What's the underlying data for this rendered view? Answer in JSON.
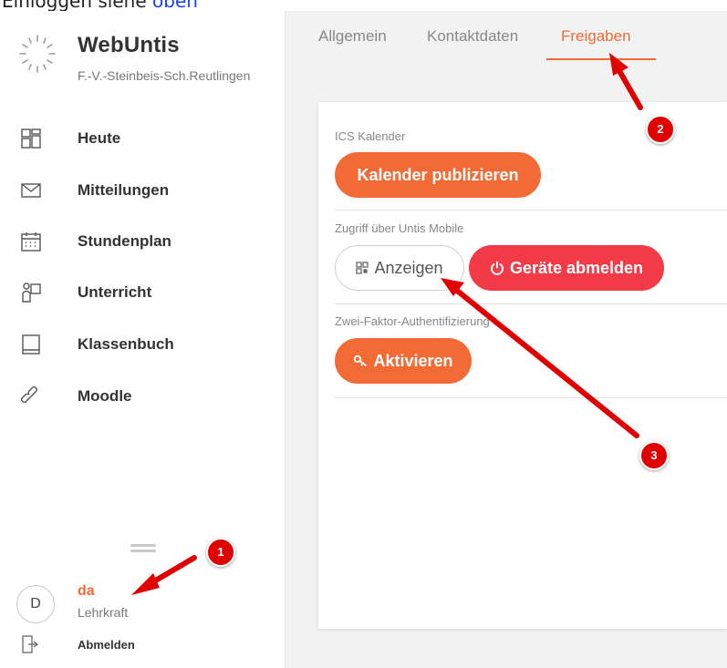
{
  "caption": {
    "prefix": "Einloggen siehe ",
    "link": "oben"
  },
  "sidebar": {
    "app_name": "WebUntis",
    "school": "F.-V.-Steinbeis-Sch.Reutlingen",
    "items": [
      {
        "label": "Heute",
        "icon": "dashboard-icon"
      },
      {
        "label": "Mitteilungen",
        "icon": "envelope-icon"
      },
      {
        "label": "Stundenplan",
        "icon": "calendar-icon"
      },
      {
        "label": "Unterricht",
        "icon": "teacher-board-icon"
      },
      {
        "label": "Klassenbuch",
        "icon": "book-icon"
      },
      {
        "label": "Moodle",
        "icon": "link-icon"
      }
    ],
    "user": {
      "avatar_initial": "D",
      "name": "da",
      "role": "Lehrkraft"
    },
    "logout_label": "Abmelden"
  },
  "tabs": [
    {
      "label": "Allgemein",
      "active": false
    },
    {
      "label": "Kontaktdaten",
      "active": false
    },
    {
      "label": "Freigaben",
      "active": true
    }
  ],
  "sections": {
    "ics": {
      "label": "ICS Kalender",
      "button": "Kalender publizieren"
    },
    "mobile": {
      "label": "Zugriff über Untis Mobile",
      "show_button": "Anzeigen",
      "logout_devices_button": "Geräte abmelden"
    },
    "twofa": {
      "label": "Zwei-Faktor-Authentifizierung",
      "button": "Aktivieren"
    }
  },
  "annotations": {
    "badges": [
      "1",
      "2",
      "3"
    ]
  },
  "colors": {
    "accent": "#f26a35",
    "danger": "#f23b47",
    "annotation": "#e00000"
  }
}
